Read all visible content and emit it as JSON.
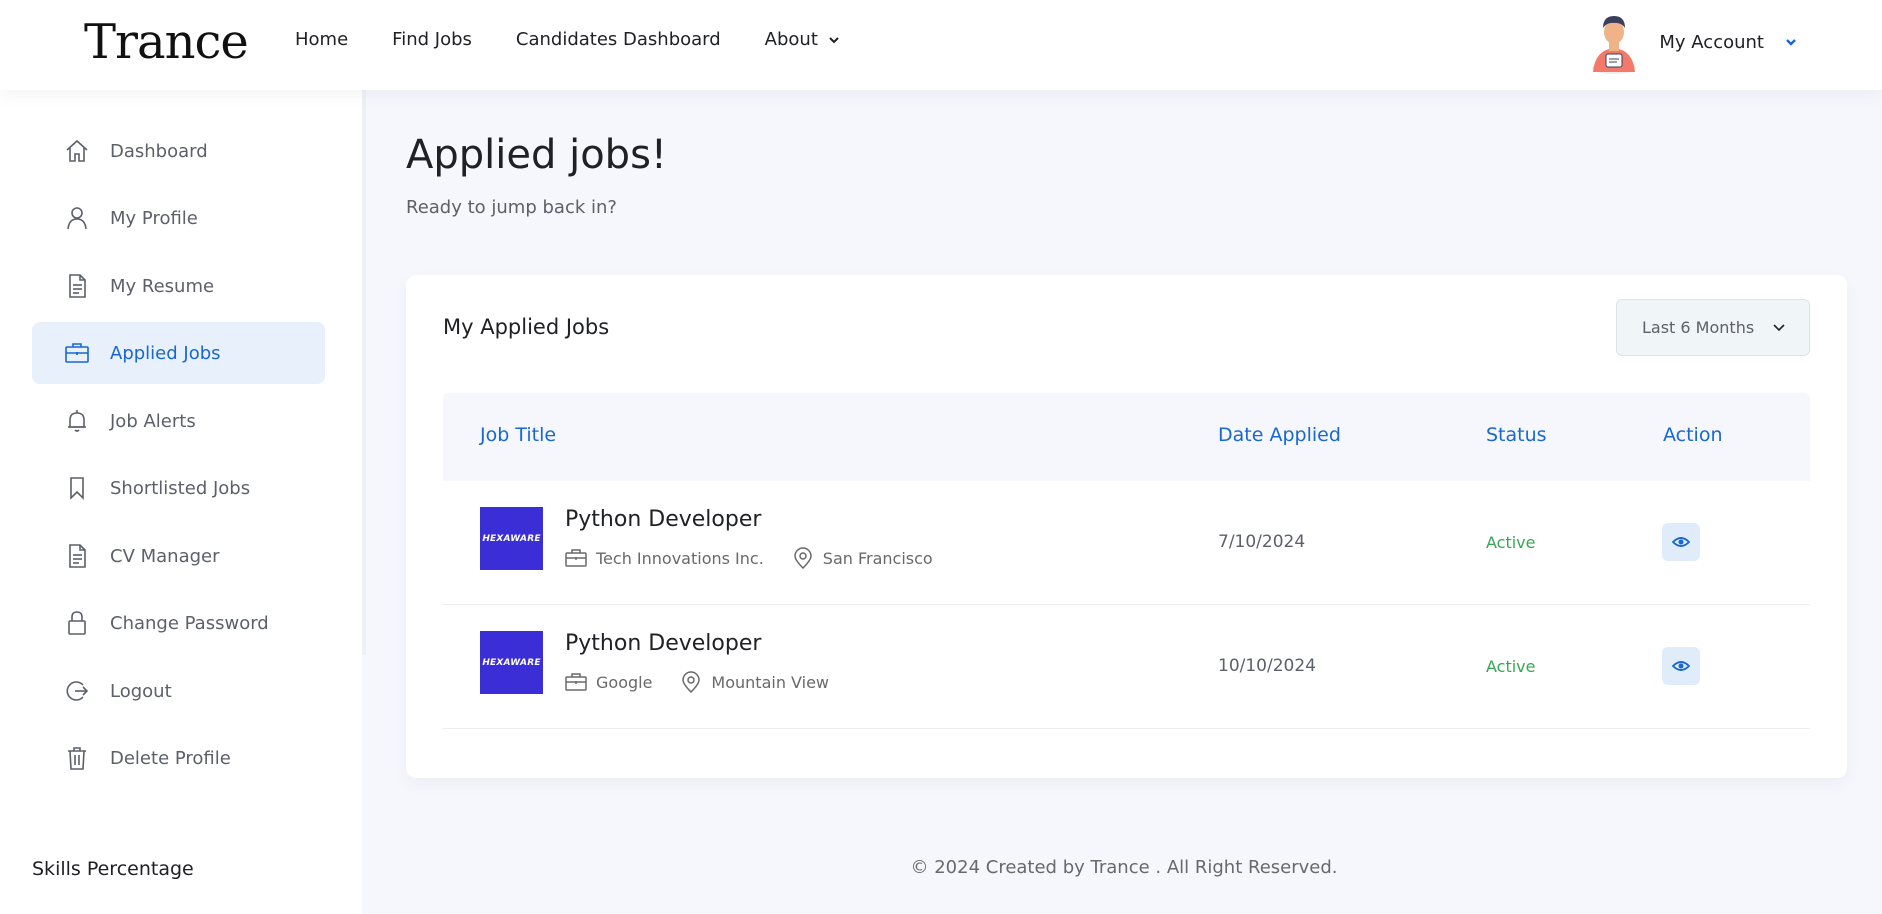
{
  "header": {
    "logo": "Trance",
    "nav": [
      {
        "label": "Home"
      },
      {
        "label": "Find Jobs"
      },
      {
        "label": "Candidates Dashboard"
      },
      {
        "label": "About",
        "has_dropdown": true
      }
    ],
    "account_label": "My Account"
  },
  "sidebar": {
    "items": [
      {
        "label": "Dashboard",
        "icon": "home-icon"
      },
      {
        "label": "My Profile",
        "icon": "user-icon"
      },
      {
        "label": "My Resume",
        "icon": "document-icon"
      },
      {
        "label": "Applied Jobs",
        "icon": "briefcase-icon",
        "active": true
      },
      {
        "label": "Job Alerts",
        "icon": "bell-icon"
      },
      {
        "label": "Shortlisted Jobs",
        "icon": "bookmark-icon"
      },
      {
        "label": "CV Manager",
        "icon": "document-icon"
      },
      {
        "label": "Change Password",
        "icon": "lock-icon"
      },
      {
        "label": "Logout",
        "icon": "logout-icon"
      },
      {
        "label": "Delete Profile",
        "icon": "trash-icon"
      }
    ],
    "skills_title": "Skills Percentage"
  },
  "main": {
    "title": "Applied jobs!",
    "subtitle": "Ready to jump back in?",
    "card": {
      "title": "My Applied Jobs",
      "filter_value": "Last 6 Months",
      "columns": [
        "Job Title",
        "Date Applied",
        "Status",
        "Action"
      ],
      "rows": [
        {
          "logo_text": "HEXAWARE",
          "title": "Python Developer",
          "company": "Tech Innovations Inc.",
          "location": "San Francisco",
          "date": "7/10/2024",
          "status": "Active"
        },
        {
          "logo_text": "HEXAWARE",
          "title": "Python Developer",
          "company": "Google",
          "location": "Mountain View",
          "date": "10/10/2024",
          "status": "Active"
        }
      ]
    }
  },
  "footer": {
    "text": "© 2024 Created by Trance . All Right Reserved."
  },
  "colors": {
    "accent": "#1967d2",
    "status_active": "#34a853",
    "company_logo_bg": "#3b2ed6"
  }
}
